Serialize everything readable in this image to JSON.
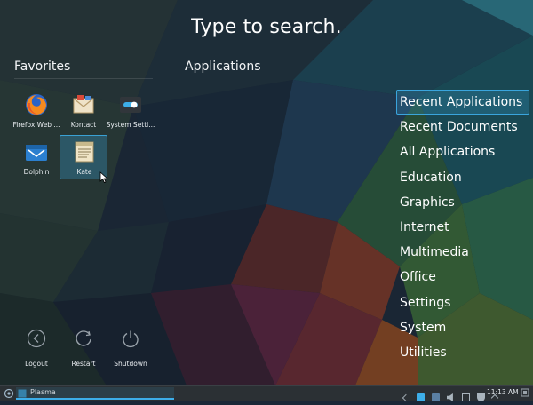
{
  "search": {
    "prompt": "Type to search."
  },
  "sections": {
    "favorites": "Favorites",
    "applications": "Applications"
  },
  "favorites": [
    {
      "label": "Firefox Web ...",
      "icon": "firefox-icon"
    },
    {
      "label": "Kontact",
      "icon": "kontact-icon"
    },
    {
      "label": "System Setti...",
      "icon": "system-settings-icon"
    },
    {
      "label": "Dolphin",
      "icon": "dolphin-icon"
    },
    {
      "label": "Kate",
      "icon": "kate-icon",
      "selected": true
    }
  ],
  "categories": [
    {
      "label": "Recent Applications",
      "active": true
    },
    {
      "label": "Recent Documents"
    },
    {
      "label": "All Applications"
    },
    {
      "label": "Education"
    },
    {
      "label": "Graphics"
    },
    {
      "label": "Internet"
    },
    {
      "label": "Multimedia"
    },
    {
      "label": "Office"
    },
    {
      "label": "Settings"
    },
    {
      "label": "System"
    },
    {
      "label": "Utilities"
    }
  ],
  "power": [
    {
      "label": "Logout",
      "icon": "logout-icon"
    },
    {
      "label": "Restart",
      "icon": "restart-icon"
    },
    {
      "label": "Shutdown",
      "icon": "shutdown-icon"
    }
  ],
  "taskbar": {
    "task_label": "Plasma",
    "clock": "11:13 AM",
    "tray_icons": [
      "arrow-icon",
      "network-icon",
      "clipboard-icon",
      "volume-icon",
      "battery-icon",
      "shield-icon",
      "expand-icon"
    ]
  },
  "colors": {
    "accent": "#3daee9",
    "taskbar": "#2b3034"
  }
}
